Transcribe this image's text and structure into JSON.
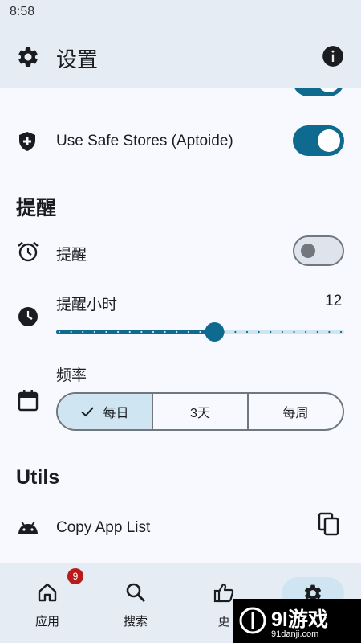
{
  "status_bar": {
    "time": "8:58"
  },
  "app_bar": {
    "title": "设置"
  },
  "settings": {
    "partial_row": {
      "icon": "device-icon",
      "switch_on": true
    },
    "safe_stores": {
      "label": "Use Safe Stores (Aptoide)",
      "icon": "shield-plus-icon",
      "switch_on": true
    },
    "reminders_section": "提醒",
    "reminder_toggle": {
      "label": "提醒",
      "icon": "alarm-icon",
      "switch_on": false
    },
    "reminder_hours": {
      "label": "提醒小时",
      "value": "12",
      "icon": "clock-icon",
      "slider_level": 0.55
    },
    "frequency": {
      "label": "频率",
      "icon": "calendar-icon",
      "options": [
        "每日",
        "3天",
        "每周"
      ],
      "selected": "每日"
    },
    "utils_section": "Utils",
    "copy_app_list": {
      "label": "Copy App List",
      "icon": "android-icon",
      "action_icon": "copy-icon"
    }
  },
  "bottom_nav": {
    "items": [
      {
        "label": "应用",
        "icon": "home-icon",
        "badge": "9"
      },
      {
        "label": "搜索",
        "icon": "search-icon"
      },
      {
        "label": "更",
        "icon": "thumbs-up-icon"
      },
      {
        "label": "",
        "icon": "gear-icon",
        "active": true
      }
    ]
  },
  "watermark": {
    "text": "9l游戏",
    "url": "91danji.com"
  },
  "colors": {
    "accent": "#0f6a8f",
    "background": "#f7f9fe",
    "bar": "#e6ecf3",
    "selected": "#cfe6f2",
    "badge": "#ba1a1a"
  }
}
